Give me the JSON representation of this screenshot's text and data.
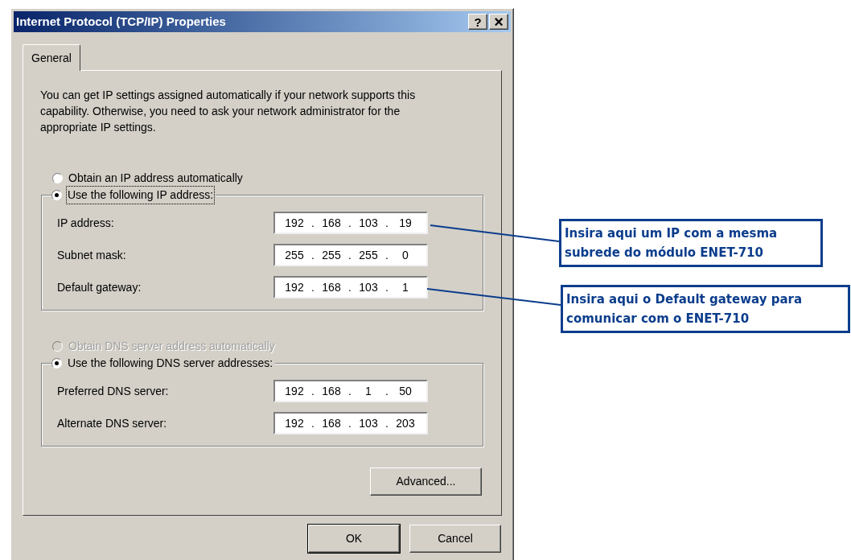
{
  "window": {
    "title": "Internet Protocol (TCP/IP) Properties",
    "buttons": [
      {
        "kind": "help",
        "label": "?"
      },
      {
        "kind": "close",
        "label": "×"
      }
    ]
  },
  "tabs": [
    {
      "label": "General",
      "selected": true
    }
  ],
  "intro": "You can get IP settings assigned automatically if your network supports this capability. Otherwise, you need to ask your network administrator for the appropriate IP settings.",
  "ip_mode": {
    "auto": {
      "label": "Obtain an IP address automatically",
      "selected": false,
      "disabled": false
    },
    "manual": {
      "label": "Use the following IP address:",
      "selected": true,
      "disabled": false,
      "focused": true
    },
    "fields": [
      {
        "label": "IP address:",
        "octets": [
          "192",
          "168",
          "103",
          "19"
        ]
      },
      {
        "label": "Subnet mask:",
        "octets": [
          "255",
          "255",
          "255",
          "0"
        ]
      },
      {
        "label": "Default gateway:",
        "octets": [
          "192",
          "168",
          "103",
          "1"
        ]
      }
    ]
  },
  "dns_mode": {
    "auto": {
      "label": "Obtain DNS server address automatically",
      "selected": false,
      "disabled": true
    },
    "manual": {
      "label": "Use the following DNS server addresses:",
      "selected": true,
      "disabled": false,
      "focused": false
    },
    "fields": [
      {
        "label": "Preferred DNS server:",
        "octets": [
          "192",
          "168",
          "1",
          "50"
        ]
      },
      {
        "label": "Alternate DNS server:",
        "octets": [
          "192",
          "168",
          "103",
          "203"
        ]
      }
    ]
  },
  "separator": ".",
  "advanced_button": "Advanced...",
  "footer_buttons": [
    {
      "label": "OK",
      "default": true
    },
    {
      "label": "Cancel",
      "default": false
    }
  ],
  "annotations": [
    "Insira aqui um IP com a mesma subrede do módulo ENET-710",
    "Insira aqui o Default gateway para comunicar com o ENET-710"
  ]
}
